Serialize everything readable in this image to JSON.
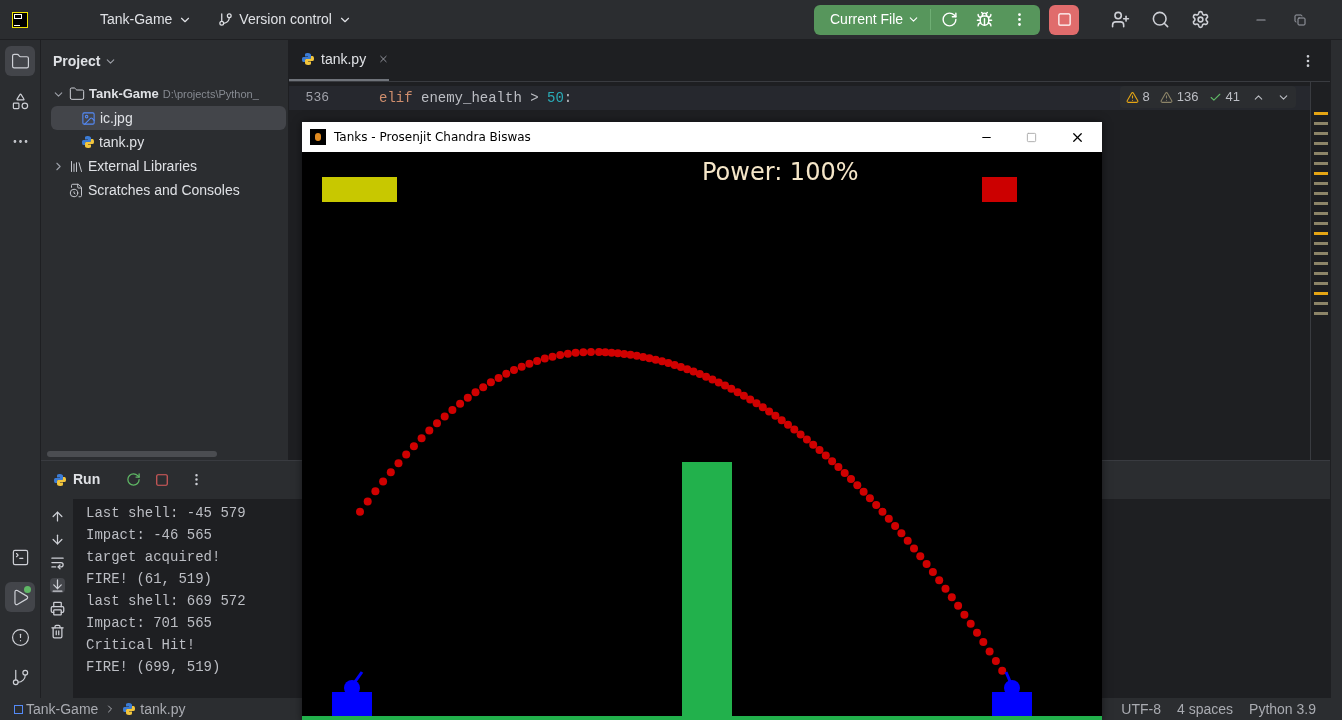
{
  "title_bar": {
    "project": "Tank-Game",
    "vcs": "Version control",
    "run_config": "Current File"
  },
  "tool_strip_top": [
    {
      "kind": "project",
      "selected": true
    },
    {
      "kind": "structure",
      "selected": false
    },
    {
      "kind": "more",
      "selected": false
    }
  ],
  "tool_strip_bottom": [
    {
      "kind": "terminal",
      "selected": false
    },
    {
      "kind": "run",
      "selected": true
    },
    {
      "kind": "problems",
      "selected": false
    },
    {
      "kind": "git",
      "selected": false
    }
  ],
  "project_panel": {
    "title": "Project",
    "tree": [
      {
        "label": "Tank-Game",
        "path": "D:\\projects\\Python_",
        "kind": "folder",
        "expanded": true,
        "children": [
          {
            "label": "ic.jpg",
            "kind": "image",
            "selected": true
          },
          {
            "label": "tank.py",
            "kind": "python",
            "selected": false
          }
        ]
      },
      {
        "label": "External Libraries",
        "kind": "library",
        "expanded": false
      },
      {
        "label": "Scratches and Consoles",
        "kind": "scratch"
      }
    ]
  },
  "editor": {
    "tabs": [
      {
        "label": "tank.py",
        "selected": true
      }
    ],
    "inspections": {
      "warnings": "8",
      "weak_warnings": "136",
      "typos": "41"
    },
    "lines": [
      {
        "number": "536",
        "current": true,
        "tokens": [
          {
            "kind": "keyword",
            "text": "elif"
          },
          {
            "kind": "plain",
            "text": " enemy_health > "
          },
          {
            "kind": "number",
            "text": "50"
          },
          {
            "kind": "plain",
            "text": ":"
          }
        ]
      }
    ]
  },
  "run_panel": {
    "title": "Run",
    "output": [
      "Last shell: -45 579",
      "Impact: -46 565",
      "target acquired!",
      "FIRE! (61, 519)",
      "last shell: 669 572",
      "Impact: 701 565",
      "Critical Hit!",
      "FIRE! (699, 519)"
    ]
  },
  "status_bar": {
    "breadcrumbs": [
      "Tank-Game",
      "tank.py"
    ],
    "items": [
      "UTF-8",
      "4 spaces",
      "Python 3.9"
    ]
  },
  "game_window": {
    "title": "Tanks - Prosenjit Chandra Biswas",
    "power": "Power: 100%",
    "health_bars": [
      {
        "color": "#c8c800"
      },
      {
        "color": "#cc0000"
      }
    ]
  }
}
